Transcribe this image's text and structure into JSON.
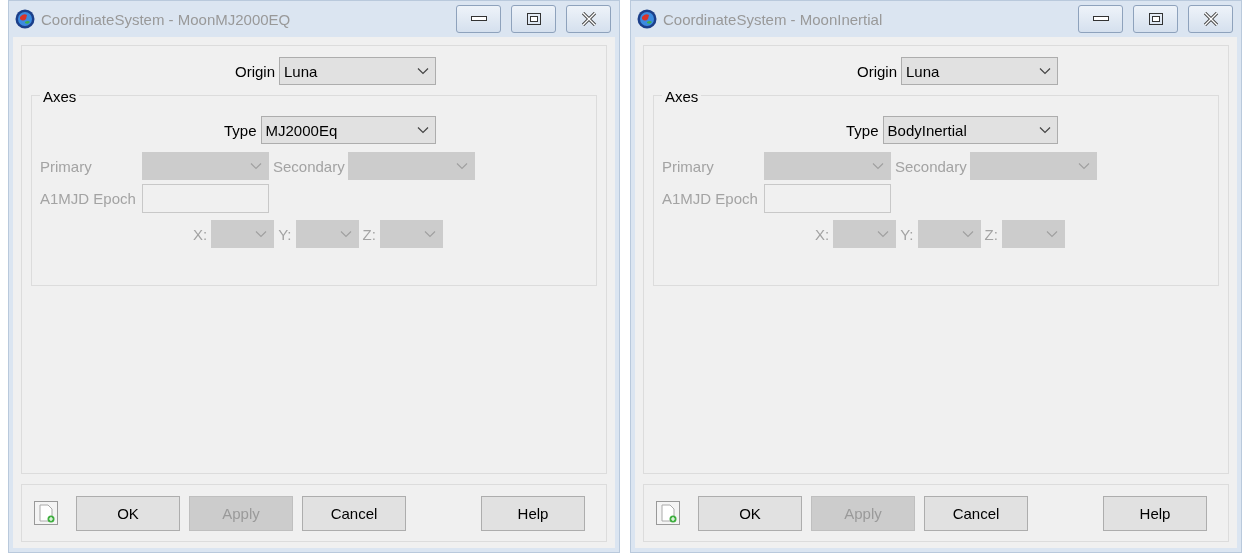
{
  "windows": [
    {
      "title": "CoordinateSystem - MoonMJ2000EQ",
      "origin": {
        "label": "Origin",
        "value": "Luna"
      },
      "axes": {
        "title": "Axes",
        "type": {
          "label": "Type",
          "value": "MJ2000Eq"
        },
        "primary": {
          "label": "Primary",
          "disabled": true
        },
        "secondary": {
          "label": "Secondary",
          "disabled": true
        },
        "epoch": {
          "label": "A1MJD Epoch",
          "disabled": true
        },
        "x": {
          "label": "X:",
          "disabled": true
        },
        "y": {
          "label": "Y:",
          "disabled": true
        },
        "z": {
          "label": "Z:",
          "disabled": true
        }
      },
      "buttons": [
        {
          "label": "OK",
          "disabled": false
        },
        {
          "label": "Apply",
          "disabled": true
        },
        {
          "label": "Cancel",
          "disabled": false
        },
        {
          "label": "Help",
          "disabled": false
        }
      ]
    },
    {
      "title": "CoordinateSystem - MoonInertial",
      "origin": {
        "label": "Origin",
        "value": "Luna"
      },
      "axes": {
        "title": "Axes",
        "type": {
          "label": "Type",
          "value": "BodyInertial"
        },
        "primary": {
          "label": "Primary",
          "disabled": true
        },
        "secondary": {
          "label": "Secondary",
          "disabled": true
        },
        "epoch": {
          "label": "A1MJD Epoch",
          "disabled": true
        },
        "x": {
          "label": "X:",
          "disabled": true
        },
        "y": {
          "label": "Y:",
          "disabled": true
        },
        "z": {
          "label": "Z:",
          "disabled": true
        }
      },
      "buttons": [
        {
          "label": "OK",
          "disabled": false
        },
        {
          "label": "Apply",
          "disabled": true
        },
        {
          "label": "Cancel",
          "disabled": false
        },
        {
          "label": "Help",
          "disabled": false
        }
      ]
    }
  ]
}
